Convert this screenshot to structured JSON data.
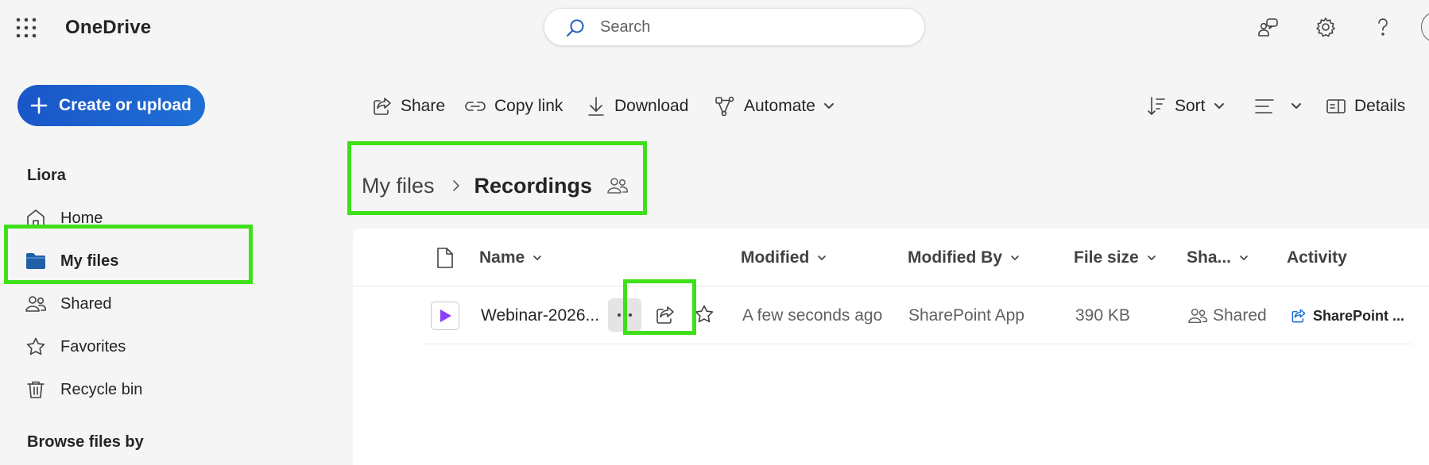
{
  "header": {
    "app_title": "OneDrive",
    "search_placeholder": "Search"
  },
  "sidebar": {
    "create_label": "Create or upload",
    "user_name": "Liora",
    "items": [
      {
        "label": "Home",
        "icon": "home-icon"
      },
      {
        "label": "My files",
        "icon": "folder-icon",
        "active": true
      },
      {
        "label": "Shared",
        "icon": "people-icon"
      },
      {
        "label": "Favorites",
        "icon": "star-icon"
      },
      {
        "label": "Recycle bin",
        "icon": "trash-icon"
      }
    ],
    "browse_title": "Browse files by"
  },
  "commands": {
    "share": "Share",
    "copy_link": "Copy link",
    "download": "Download",
    "automate": "Automate",
    "sort": "Sort",
    "details": "Details"
  },
  "breadcrumb": {
    "root": "My files",
    "current": "Recordings"
  },
  "table": {
    "columns": [
      "Name",
      "Modified",
      "Modified By",
      "File size",
      "Sha...",
      "Activity"
    ],
    "rows": [
      {
        "name": "Webinar-2026...",
        "modified": "A few seconds ago",
        "modified_by": "SharePoint App",
        "file_size": "390 KB",
        "sharing": "Shared",
        "activity": "SharePoint ..."
      }
    ]
  },
  "colors": {
    "accent": "#1f6fd6",
    "highlight": "#3ee01a",
    "video": "#8a3ffc"
  }
}
